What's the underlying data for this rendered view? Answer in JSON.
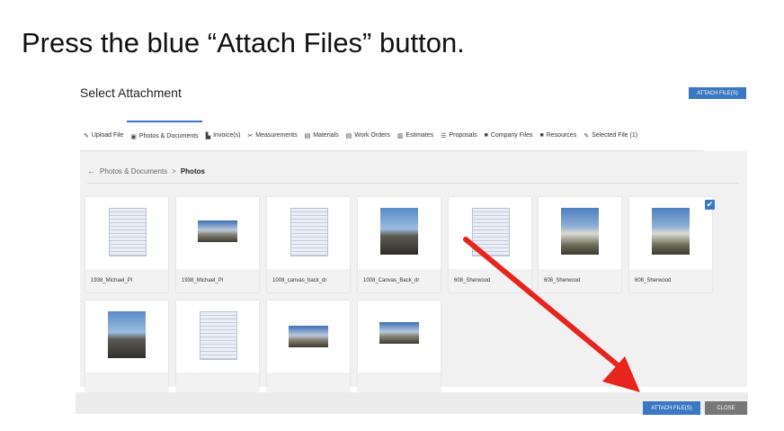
{
  "instruction": "Press the blue “Attach Files” button.",
  "dialog": {
    "title": "Select Attachment",
    "attach_label": "ATTACH FILE(S)",
    "close_label": "CLOSE"
  },
  "tabs": [
    {
      "icon": "✎",
      "label": "Upload File"
    },
    {
      "icon": "▣",
      "label": "Photos & Documents"
    },
    {
      "icon": "▙",
      "label": "Invoice(s)"
    },
    {
      "icon": "✂",
      "label": "Measurements"
    },
    {
      "icon": "▤",
      "label": "Materials"
    },
    {
      "icon": "▤",
      "label": "Work Orders"
    },
    {
      "icon": "▥",
      "label": "Estimates"
    },
    {
      "icon": "☰",
      "label": "Proposals"
    },
    {
      "icon": "■",
      "label": "Company Files"
    },
    {
      "icon": "■",
      "label": "Resources"
    },
    {
      "icon": "✎",
      "label": "Selected File (1)"
    }
  ],
  "breadcrumb": {
    "back_icon": "←",
    "parent": "Photos & Documents",
    "separator": ">",
    "current": "Photos"
  },
  "files": [
    {
      "name": "1938_Michael_Pl",
      "kind": "document"
    },
    {
      "name": "1938_Michael_Pl",
      "kind": "wide-photo"
    },
    {
      "name": "1008_canvas_back_dr",
      "kind": "document"
    },
    {
      "name": "1008_Canvas_Back_dr",
      "kind": "photo"
    },
    {
      "name": "608_Sherwood",
      "kind": "document"
    },
    {
      "name": "608_Sherwood",
      "kind": "house"
    },
    {
      "name": "608_Sherwood",
      "kind": "house",
      "selected": true
    },
    {
      "name": "",
      "kind": "photo"
    },
    {
      "name": "",
      "kind": "document"
    },
    {
      "name": "",
      "kind": "wide-photo"
    },
    {
      "name": "",
      "kind": "wide-photo"
    }
  ],
  "colors": {
    "accent": "#3a78c3",
    "arrow": "#e8241c",
    "close": "#777777"
  }
}
